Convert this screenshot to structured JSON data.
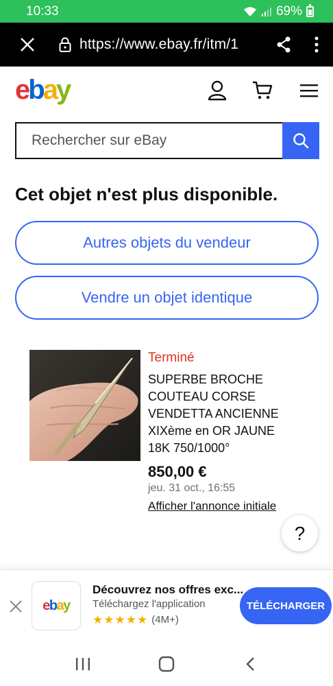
{
  "status_bar": {
    "time": "10:33",
    "battery": "69%"
  },
  "browser": {
    "url": "https://www.ebay.fr/itm/1"
  },
  "header": {
    "logo": {
      "e": "e",
      "b": "b",
      "a": "a",
      "y": "y"
    },
    "icons": [
      "user-icon",
      "cart-icon",
      "menu-icon"
    ]
  },
  "search": {
    "placeholder": "Rechercher sur eBay"
  },
  "main": {
    "unavailable_text": "Cet objet n'est plus disponible.",
    "seller_button": "Autres objets du vendeur",
    "sell_button": "Vendre un objet identique"
  },
  "listing": {
    "status": "Terminé",
    "title": "SUPERBE BROCHE COUTEAU CORSE VENDETTA ANCIENNE XIXème en OR JAUNE 18K 750/1000°",
    "price": "850,00 €",
    "date": "jeu. 31 oct., 16:55",
    "link": "Afficher l'annonce initiale"
  },
  "help": {
    "label": "?"
  },
  "app_banner": {
    "title": "Découvrez nos offres exc...",
    "subtitle": "Téléchargez l'application",
    "rating_count": "(4M+)",
    "stars": 5,
    "button": "TÉLÉCHARGER",
    "logo": {
      "e": "e",
      "b": "b",
      "a": "a",
      "y": "y"
    }
  },
  "colors": {
    "accent": "#3665f3",
    "status_red": "#e0301e",
    "statusbar": "#2ec05a"
  }
}
